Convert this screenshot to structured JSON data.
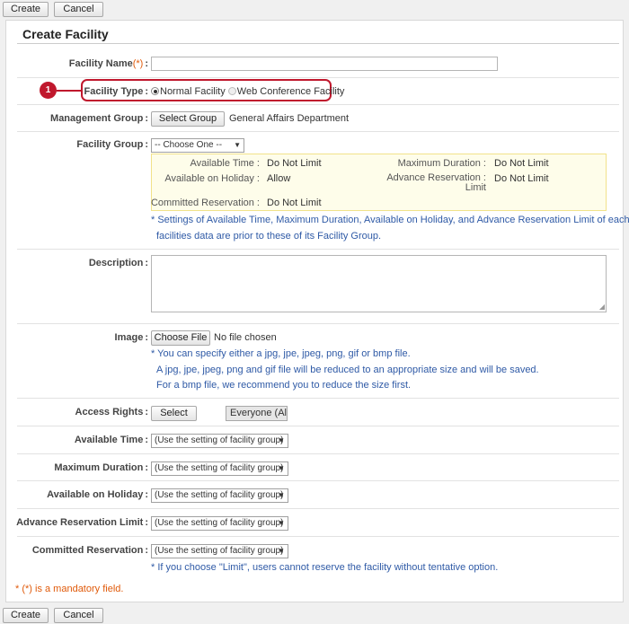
{
  "toolbar": {
    "create_label": "Create",
    "cancel_label": "Cancel"
  },
  "page_title": "Create Facility",
  "fields": {
    "facility_name": {
      "label": "Facility Name",
      "required_mark": "(*)",
      "value": ""
    },
    "facility_type": {
      "label": "Facility Type",
      "options": [
        "Normal Facility",
        "Web Conference Facility"
      ],
      "selected": "Normal Facility"
    },
    "management_group": {
      "label": "Management Group",
      "button": "Select Group",
      "value": "General Affairs Department"
    },
    "facility_group": {
      "label": "Facility Group",
      "select_value": "-- Choose One --",
      "info": {
        "available_time_label": "Available Time",
        "available_time_value": "Do Not Limit",
        "maximum_duration_label": "Maximum Duration",
        "maximum_duration_value": "Do Not Limit",
        "available_on_holiday_label": "Available on Holiday",
        "available_on_holiday_value": "Allow",
        "advance_reservation_label_line1": "Advance Reservation",
        "advance_reservation_label_line2": "Limit",
        "advance_reservation_value": "Do Not Limit",
        "committed_reservation_label": "Committed Reservation",
        "committed_reservation_value": "Do Not Limit"
      },
      "note_line1": "* Settings of Available Time, Maximum Duration, Available on Holiday, and Advance Reservation Limit of each",
      "note_line2": "facilities data are prior to these of its Facility Group."
    },
    "description": {
      "label": "Description",
      "value": ""
    },
    "image": {
      "label": "Image",
      "button": "Choose File",
      "status": "No file chosen",
      "note_line1": "* You can specify either a jpg, jpe, jpeg, png, gif or bmp file.",
      "note_line2": "A jpg, jpe, jpeg, png and gif file will be reduced to an appropriate size and will be saved.",
      "note_line3": "For a bmp file, we recommend you to reduce the size first."
    },
    "access_rights": {
      "label": "Access Rights",
      "button": "Select",
      "value": "Everyone (All Us..."
    },
    "available_time": {
      "label": "Available Time",
      "select_value": "(Use the setting of facility group)"
    },
    "maximum_duration": {
      "label": "Maximum Duration",
      "select_value": "(Use the setting of facility group)"
    },
    "available_on_holiday": {
      "label": "Available on Holiday",
      "select_value": "(Use the setting of facility group)"
    },
    "advance_reservation_limit": {
      "label": "Advance Reservation Limit",
      "select_value": "(Use the setting of facility group)"
    },
    "committed_reservation": {
      "label": "Committed Reservation",
      "select_value": "(Use the setting of facility group)",
      "note": "* If you choose \"Limit\", users cannot reserve the facility without tentative option."
    }
  },
  "callout": {
    "number": "1"
  },
  "footer": {
    "mandatory_note": "* (*) is a mandatory field."
  },
  "colors": {
    "accent_red": "#c0182d",
    "note_blue": "#2f5aa6",
    "required_orange": "#e05a0a",
    "info_bg": "#fefdea"
  }
}
